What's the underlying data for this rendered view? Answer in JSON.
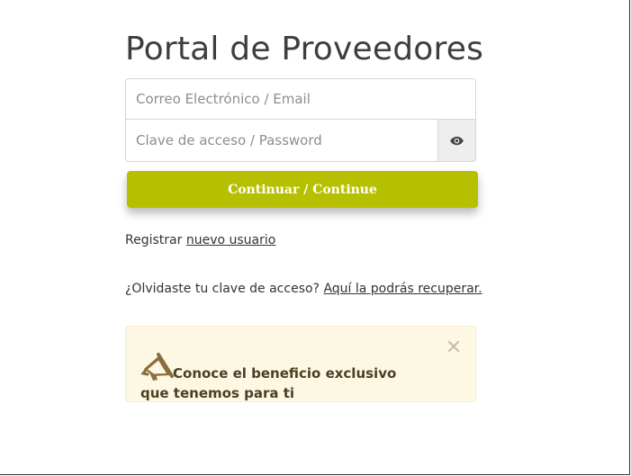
{
  "page": {
    "title": "Portal de Proveedores"
  },
  "form": {
    "email_placeholder": "Correo Electrónico / Email",
    "password_placeholder": "Clave de acceso / Password",
    "show_password_icon": "eye-icon",
    "continue_label": "Continuar / Continue"
  },
  "register": {
    "prefix": "Registrar",
    "link_label": "nuevo usuario"
  },
  "forgot": {
    "prefix": "¿Olvidaste tu clave de acceso?",
    "link_label": "Aquí la podrás recuperar."
  },
  "alert": {
    "icon": "megaphone-icon",
    "text": "Conoce el beneficio exclusivo que tenemos para ti",
    "close_icon": "close-icon"
  },
  "colors": {
    "accent": "#b6c000",
    "alert_bg": "#fcf8e3",
    "alert_text": "#4d3f23",
    "icon_brown": "#8a6d3b"
  }
}
